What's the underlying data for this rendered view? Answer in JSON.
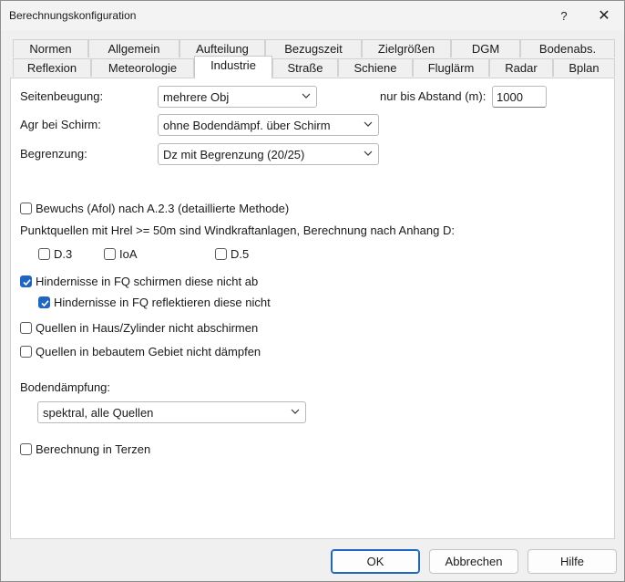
{
  "window": {
    "title": "Berechnungskonfiguration",
    "help_label": "?",
    "close_label": "✕"
  },
  "tabs": {
    "row1": [
      "Normen",
      "Allgemein",
      "Aufteilung",
      "Bezugszeit",
      "Zielgrößen",
      "DGM",
      "Bodenabs."
    ],
    "row2": [
      "Reflexion",
      "Meteorologie",
      "Industrie",
      "Straße",
      "Schiene",
      "Fluglärm",
      "Radar",
      "Bplan"
    ],
    "active": "Industrie"
  },
  "form": {
    "seitenbeugung": {
      "label": "Seitenbeugung:",
      "value": "mehrere Obj"
    },
    "abstand": {
      "label": "nur bis Abstand (m):",
      "value": "1000"
    },
    "agr": {
      "label": "Agr bei Schirm:",
      "value": "ohne Bodendämpf. über Schirm"
    },
    "begrenzung": {
      "label": "Begrenzung:",
      "value": "Dz mit Begrenzung (20/25)"
    },
    "bewuchs": {
      "label": "Bewuchs (Afol) nach A.2.3 (detaillierte Methode)",
      "checked": false
    },
    "punktquellen_text": "Punktquellen mit Hrel >= 50m sind Windkraftanlagen, Berechnung nach Anhang D:",
    "d3": {
      "label": "D.3",
      "checked": false
    },
    "ioa": {
      "label": "IoA",
      "checked": false
    },
    "d5": {
      "label": "D.5",
      "checked": false
    },
    "hindernisse_schirmen": {
      "label": "Hindernisse in FQ schirmen diese nicht ab",
      "checked": true
    },
    "hindernisse_reflektieren": {
      "label": "Hindernisse in FQ reflektieren diese nicht",
      "checked": true
    },
    "quellen_haus": {
      "label": "Quellen in Haus/Zylinder nicht abschirmen",
      "checked": false
    },
    "quellen_bebaut": {
      "label": "Quellen in bebautem Gebiet nicht dämpfen",
      "checked": false
    },
    "bodendaempfung": {
      "label": "Bodendämpfung:",
      "value": "spektral, alle Quellen"
    },
    "terzen": {
      "label": "Berechnung in Terzen",
      "checked": false
    }
  },
  "buttons": {
    "ok": "OK",
    "cancel": "Abbrechen",
    "help": "Hilfe"
  },
  "colors": {
    "accent": "#1f66c1",
    "panel": "#ffffff",
    "chrome": "#f0f0f0"
  },
  "icons": {
    "combo_arrow": "chevron-down-icon",
    "checkmark": "check-icon"
  }
}
